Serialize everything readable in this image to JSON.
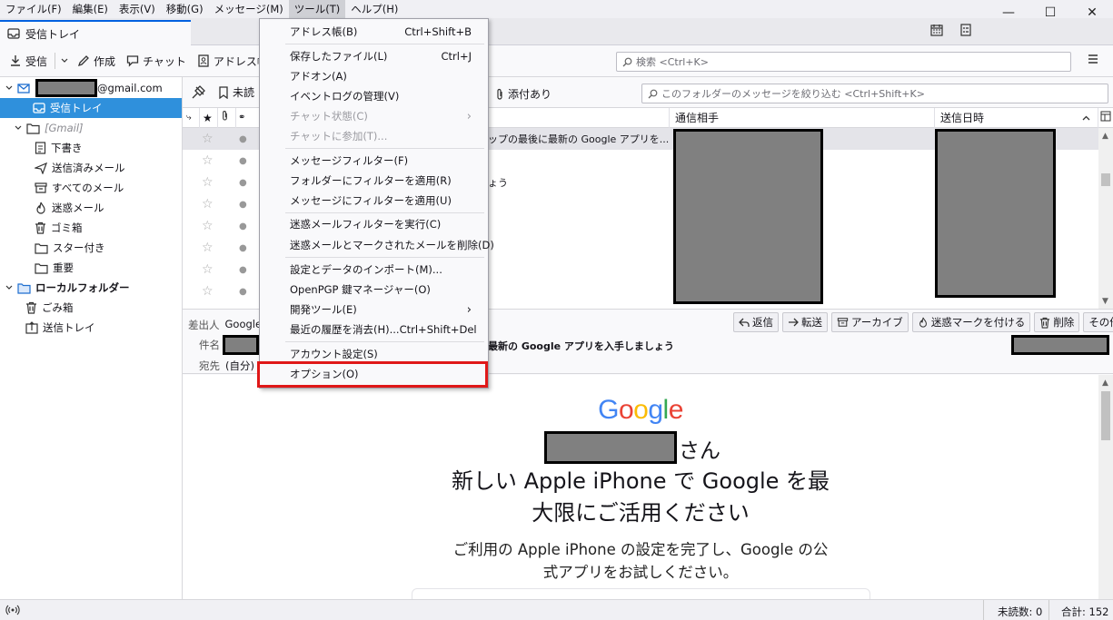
{
  "menubar": {
    "items": [
      "ファイル(F)",
      "編集(E)",
      "表示(V)",
      "移動(G)",
      "メッセージ(M)",
      "ツール(T)",
      "ヘルプ(H)"
    ]
  },
  "window_controls": {
    "minimize": "—",
    "maximize": "☐",
    "close": "✕"
  },
  "tab": {
    "label": "受信トレイ"
  },
  "toolbar": {
    "get_mail": "受信",
    "compose": "作成",
    "chat": "チャット",
    "address_book": "アドレス帳",
    "search_placeholder": "検索 <Ctrl+K>"
  },
  "folders": {
    "account_suffix": "@gmail.com",
    "inbox": "受信トレイ",
    "gmail": "[Gmail]",
    "drafts": "下書き",
    "sent": "送信済みメール",
    "all_mail": "すべてのメール",
    "spam": "迷惑メール",
    "trash": "ゴミ箱",
    "starred": "スター付き",
    "important": "重要",
    "local_folders": "ローカルフォルダー",
    "local_trash": "ごみ箱",
    "outbox": "送信トレイ"
  },
  "quickfilter": {
    "unread": "未読",
    "attachments": "添付あり",
    "filter_placeholder": "このフォルダーのメッセージを絞り込む <Ctrl+Shift+K>"
  },
  "columns": {
    "correspondent": "通信相手",
    "date": "送信日時"
  },
  "thread_rows": {
    "row1_subject": "ップの最後に最新の Google アプリを...",
    "row3_subject": "ょう"
  },
  "header": {
    "from_label": "差出人",
    "from_value": "Google",
    "subject_label": "件名",
    "subject_value": "最新の Google アプリを入手しましょう",
    "to_label": "宛先",
    "to_value": "(自分)",
    "buttons": [
      "返信",
      "転送",
      "アーカイブ",
      "迷惑マークを付ける",
      "削除",
      "その他"
    ]
  },
  "body": {
    "logo": "Google",
    "greeting_suffix": "さん",
    "headline_1": "新しい Apple iPhone で Google を最",
    "headline_2": "大限にご活用ください",
    "text_1": "ご利用の Apple iPhone の設定を完了し、Google の公",
    "text_2": "式アプリをお試しください。"
  },
  "statusbar": {
    "unread": "未読数: 0",
    "total": "合計: 152"
  },
  "tools_menu": {
    "address_book": "アドレス帳(B)",
    "address_book_sc": "Ctrl+Shift+B",
    "saved_files": "保存したファイル(L)",
    "saved_files_sc": "Ctrl+J",
    "addons": "アドオン(A)",
    "event_log": "イベントログの管理(V)",
    "chat_status": "チャット状態(C)",
    "join_chat": "チャットに参加(T)...",
    "message_filters": "メッセージフィルター(F)",
    "apply_filters_folder": "フォルダーにフィルターを適用(R)",
    "apply_filters_message": "メッセージにフィルターを適用(U)",
    "run_junk": "迷惑メールフィルターを実行(C)",
    "delete_junk": "迷惑メールとマークされたメールを削除(D)",
    "import": "設定とデータのインポート(M)...",
    "openpgp": "OpenPGP 鍵マネージャー(O)",
    "dev_tools": "開発ツール(E)",
    "clear_history": "最近の履歴を消去(H)...",
    "clear_history_sc": "Ctrl+Shift+Del",
    "account_settings": "アカウント設定(S)",
    "options": "オプション(O)"
  }
}
